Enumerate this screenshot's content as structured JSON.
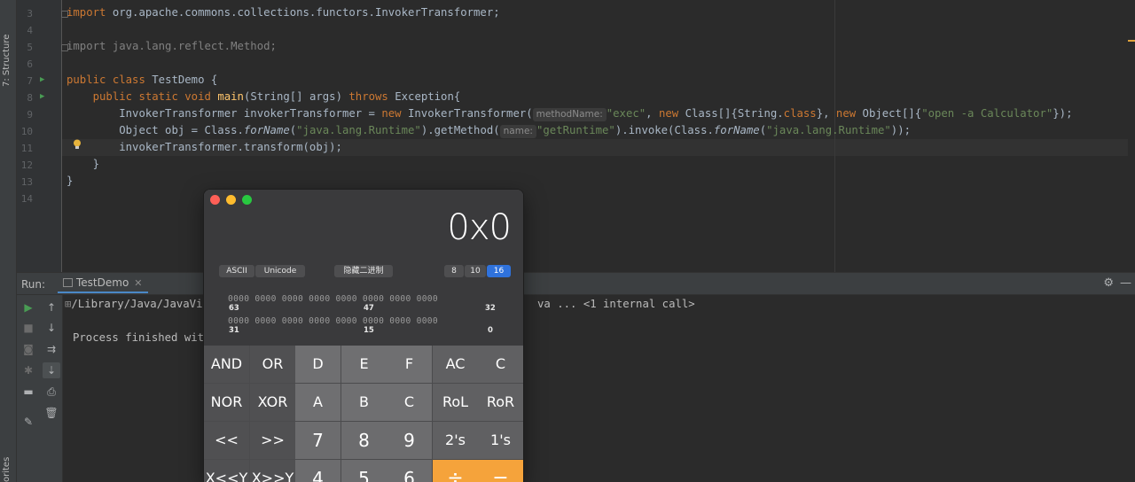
{
  "sidebar": {
    "structure_tab": "7: Structure",
    "favorites_tab": "orites"
  },
  "editor": {
    "line_numbers": [
      "3",
      "4",
      "5",
      "6",
      "7",
      "8",
      "9",
      "10",
      "11",
      "12",
      "13",
      "14"
    ],
    "l3": {
      "kw": "import",
      "rest": " org.apache.commons.collections.functors.InvokerTransformer;"
    },
    "l5": "import java.lang.reflect.Method;",
    "l7": {
      "kw1": "public",
      "kw2": "class",
      "name": "TestDemo {"
    },
    "l8": {
      "kw1": "public",
      "kw2": "static",
      "kw3": "void",
      "fn": "main",
      "args": "(String[] args) ",
      "kw4": "throws",
      "rest": " Exception{"
    },
    "l9": {
      "a": "InvokerTransformer invokerTransformer = ",
      "kw_new": "new",
      "b": " InvokerTransformer(",
      "hint": "methodName:",
      "s1": "\"exec\"",
      "c": ", ",
      "kw_new2": "new",
      "d": " Class[]{String.",
      "kw_class": "class",
      "e": "}, ",
      "kw_new3": "new",
      "f": " Object[]{",
      "s2": "\"open -a Calculator\"",
      "g": "});"
    },
    "l10": {
      "a": "Object obj = Class.",
      "it1": "forName",
      "b": "(",
      "s1": "\"java.lang.Runtime\"",
      "c": ").getMethod(",
      "hint": "name:",
      "s2": "\"getRuntime\"",
      "d": ").invoke(Class.",
      "it2": "forName",
      "e": "(",
      "s3": "\"java.lang.Runtime\"",
      "f": "));"
    },
    "l11": "invokerTransformer.transform(obj);",
    "l12": "}",
    "l13": "}"
  },
  "run": {
    "label": "Run:",
    "tab": "TestDemo",
    "console_cmd": "/Library/Java/JavaVi",
    "console_tail": "va ... <1 internal call>",
    "console_finished": "Process finished wit"
  },
  "calculator": {
    "display": "0x0",
    "ascii": "ASCII",
    "unicode": "Unicode",
    "hide_binary": "隐藏二进制",
    "bases": [
      "8",
      "10",
      "16"
    ],
    "active_base": "16",
    "bits_row1": "0000 0000 0000 0000 0000 0000 0000 0000",
    "bits_row2": "0000 0000 0000 0000 0000 0000 0000 0000",
    "bit_labels": [
      "63",
      "47",
      "32",
      "31",
      "15",
      "0"
    ],
    "keys_row1": [
      "AND",
      "OR",
      "D",
      "E",
      "F",
      "AC",
      "C"
    ],
    "keys_row2": [
      "NOR",
      "XOR",
      "A",
      "B",
      "C",
      "RoL",
      "RoR"
    ],
    "keys_row3": [
      "<<",
      ">>",
      "7",
      "8",
      "9",
      "2's",
      "1's"
    ],
    "keys_row4": [
      "X<<Y",
      "X>>Y",
      "4",
      "5",
      "6",
      "÷",
      "−"
    ]
  }
}
